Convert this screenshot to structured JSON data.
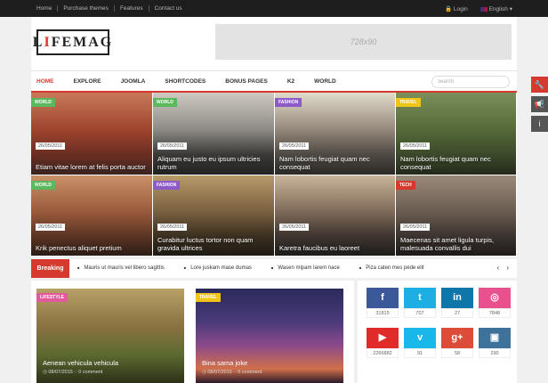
{
  "topbar": {
    "links": [
      "Home",
      "Purchase themes",
      "Features",
      "Contact us"
    ],
    "login": "Login",
    "language": "English"
  },
  "logo": {
    "text_a": "L",
    "text_b": "I",
    "text_c": "FEMAG"
  },
  "ad": {
    "label": "728x90"
  },
  "nav": {
    "items": [
      "HOME",
      "EXPLORE",
      "JOOMLA",
      "SHORTCODES",
      "BONUS PAGES",
      "K2",
      "WORLD"
    ],
    "search_placeholder": "search"
  },
  "tiles": [
    {
      "cat": "WORLD",
      "catColor": "#5cb85c",
      "date": "26/05/2011",
      "title": "Etiam vitae lorem at felis porta auctor",
      "bg": "linear-gradient(180deg,#c67a5a 0%,#a0442e 45%,#6b2e22 75%,#3b2420 100%)"
    },
    {
      "cat": "WORLD",
      "catColor": "#5cb85c",
      "date": "26/05/2011",
      "title": "Aliquam eu justo eu ipsum ultricies rutrum",
      "bg": "linear-gradient(180deg,#cfcac2 0%,#8e8b86 45%,#3c3a38 75%,#222 100%)"
    },
    {
      "cat": "FASHION",
      "catColor": "#8e5ac8",
      "date": "26/05/2011",
      "title": "Nam lobortis feugiat quam nec consequat",
      "bg": "linear-gradient(180deg,#e0dccc 0%,#9e9283 40%,#4f4a44 75%,#2c2926 100%)"
    },
    {
      "cat": "TRAVEL",
      "catColor": "#f0c419",
      "date": "26/05/2011",
      "title": "Nam lobortis feugiat quam nec consequat",
      "bg": "linear-gradient(180deg,#7a8f5a 0%,#5a6e3c 40%,#3c4a2a 75%,#232a1c 100%)"
    },
    {
      "cat": "WORLD",
      "catColor": "#5cb85c",
      "date": "26/05/2011",
      "title": "Krik penectus aliquet pretium",
      "bg": "linear-gradient(180deg,#c99268 0%,#9a5a3c 45%,#5c3524 75%,#2c1c16 100%)"
    },
    {
      "cat": "FASHION",
      "catColor": "#8e5ac8",
      "date": "26/05/2011",
      "title": "Curabitur luctus tortor non quam gravida ultrices",
      "bg": "linear-gradient(180deg,#b89a6a 0%,#7a6040 45%,#3c3020 75%,#1e1a14 100%)"
    },
    {
      "cat": "",
      "catColor": "",
      "date": "26/05/2011",
      "title": "Karetra faucibus eu laoreet",
      "bg": "linear-gradient(180deg,#c9b49a 0%,#7e6a58 45%,#3f3630 75%,#1e1c1a 100%)"
    },
    {
      "cat": "TECH",
      "catColor": "#d63a2f",
      "date": "26/05/2011",
      "title": "Maecenas sit amet ligula turpis, malesuada convallis dui",
      "bg": "linear-gradient(180deg,#9a8a7a 0%,#6a5c50 45%,#3c3430 75%,#1e1a18 100%)"
    }
  ],
  "breaking": {
    "label": "Breaking",
    "items": [
      "Mauris ut mauris vel libero sagittis",
      "Lore juskam mase dumas",
      "Wasen mipam larem nace",
      "Piza caten mes pede elit"
    ],
    "arrows": "‹ ›"
  },
  "posts": [
    {
      "cat": "LIFESTYLE",
      "catColor": "#e05a9c",
      "title": "Aenean vehicula vehicula",
      "meta": "◷ 08/07/2015  ◌ 0 comment",
      "bg": "linear-gradient(180deg,#b8a068 0%,#8a7240 40%,#5c6a30 70%,#2c3018 100%)"
    },
    {
      "cat": "TRAVEL",
      "catColor": "#f0c419",
      "title": "Bina sama joke",
      "meta": "◷ 08/07/2015  ◌ 0 comment",
      "bg": "linear-gradient(180deg,#2a2a5a 0%,#4a3a7a 35%,#8a4a8a 60%,#d0704a 85%,#2a1a2a 100%)"
    }
  ],
  "social": [
    {
      "icon": "f",
      "color": "#3b5998",
      "count": "31815"
    },
    {
      "icon": "t",
      "color": "#1daee3",
      "count": "707"
    },
    {
      "icon": "in",
      "color": "#0e76a8",
      "count": "27"
    },
    {
      "icon": "◎",
      "color": "#e8518d",
      "count": "7848"
    },
    {
      "icon": "▶",
      "color": "#e12b28",
      "count": "2266882"
    },
    {
      "icon": "v",
      "color": "#1ab7ea",
      "count": "91"
    },
    {
      "icon": "g+",
      "color": "#dd4b39",
      "count": "58"
    },
    {
      "icon": "▣",
      "color": "#3f729b",
      "count": "290"
    }
  ],
  "tools": [
    {
      "icon": "🔧",
      "color": "#d63a2f"
    },
    {
      "icon": "📢",
      "color": "#555"
    },
    {
      "icon": "i",
      "color": "#555"
    }
  ]
}
